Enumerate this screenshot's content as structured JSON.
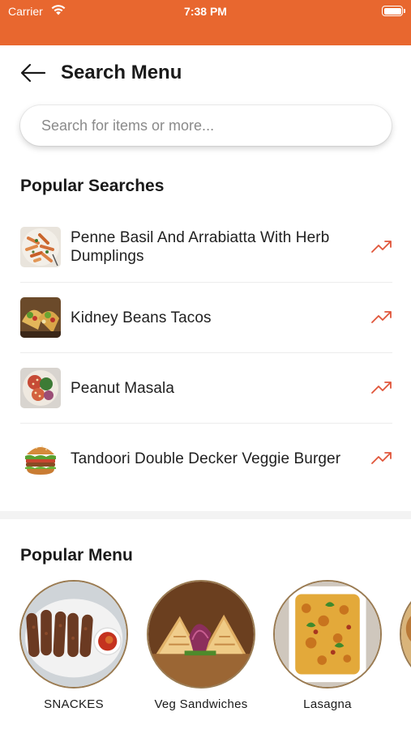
{
  "status_bar": {
    "carrier": "Carrier",
    "time": "7:38 PM"
  },
  "header": {
    "title": "Search Menu"
  },
  "search": {
    "placeholder": "Search for items or more..."
  },
  "popular_searches": {
    "title": "Popular Searches",
    "items": [
      {
        "label": "Penne Basil And Arrabiatta With Herb Dumplings",
        "icon": "trending-up-icon"
      },
      {
        "label": "Kidney Beans Tacos",
        "icon": "trending-up-icon"
      },
      {
        "label": "Peanut Masala",
        "icon": "trending-up-icon"
      },
      {
        "label": "Tandoori Double Decker Veggie Burger",
        "icon": "trending-up-icon"
      }
    ]
  },
  "popular_menu": {
    "title": "Popular Menu",
    "items": [
      {
        "name": "SNACKES"
      },
      {
        "name": "Veg Sandwiches"
      },
      {
        "name": "Lasagna"
      }
    ]
  },
  "colors": {
    "accent": "#e8672f",
    "trend": "#e0553a"
  }
}
